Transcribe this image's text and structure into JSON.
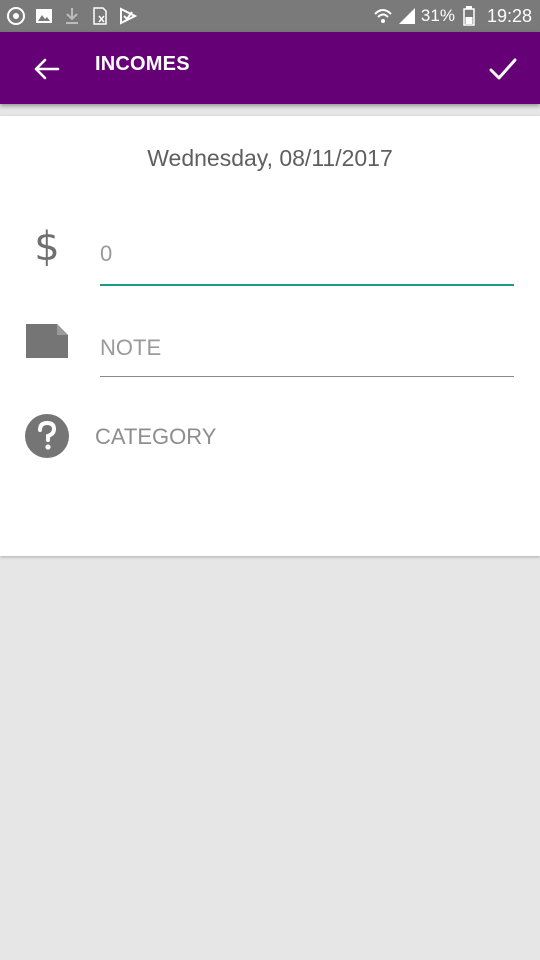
{
  "status_bar": {
    "left_icons": [
      "eye-icon",
      "image-icon",
      "download-icon",
      "sim-icon",
      "play-check-icon"
    ],
    "battery": "31%",
    "time": "19:28"
  },
  "app_bar": {
    "title": "INCOMES",
    "back_icon": "arrow-left-icon",
    "confirm_icon": "checkmark-icon",
    "color": "#660077"
  },
  "form": {
    "date": "Wednesday, 08/11/2017",
    "amount": {
      "icon": "dollar-icon",
      "symbol": "$",
      "value": "",
      "placeholder": "0"
    },
    "note": {
      "icon": "note-icon",
      "value": "",
      "placeholder": "NOTE"
    },
    "category": {
      "icon": "question-icon",
      "label": "CATEGORY"
    }
  },
  "colors": {
    "accent": "#1a9a8a",
    "background": "#e6e6e6"
  }
}
